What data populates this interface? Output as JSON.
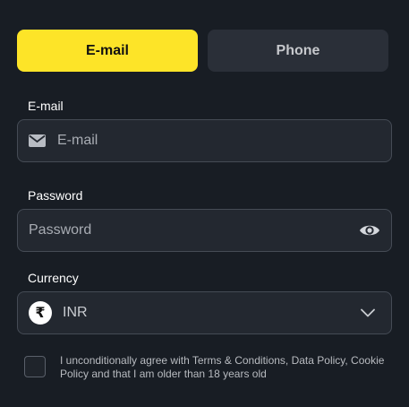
{
  "tabs": {
    "email_label": "E-mail",
    "phone_label": "Phone"
  },
  "email": {
    "label": "E-mail",
    "placeholder": "E-mail"
  },
  "password": {
    "label": "Password",
    "placeholder": "Password"
  },
  "currency": {
    "label": "Currency",
    "symbol": "₹",
    "value": "INR"
  },
  "terms": {
    "text": "I unconditionally agree with Terms & Conditions, Data Policy, Cookie Policy and that I am older than 18 years old"
  },
  "colors": {
    "accent": "#fde428",
    "background": "#181d24",
    "field": "#232830"
  }
}
